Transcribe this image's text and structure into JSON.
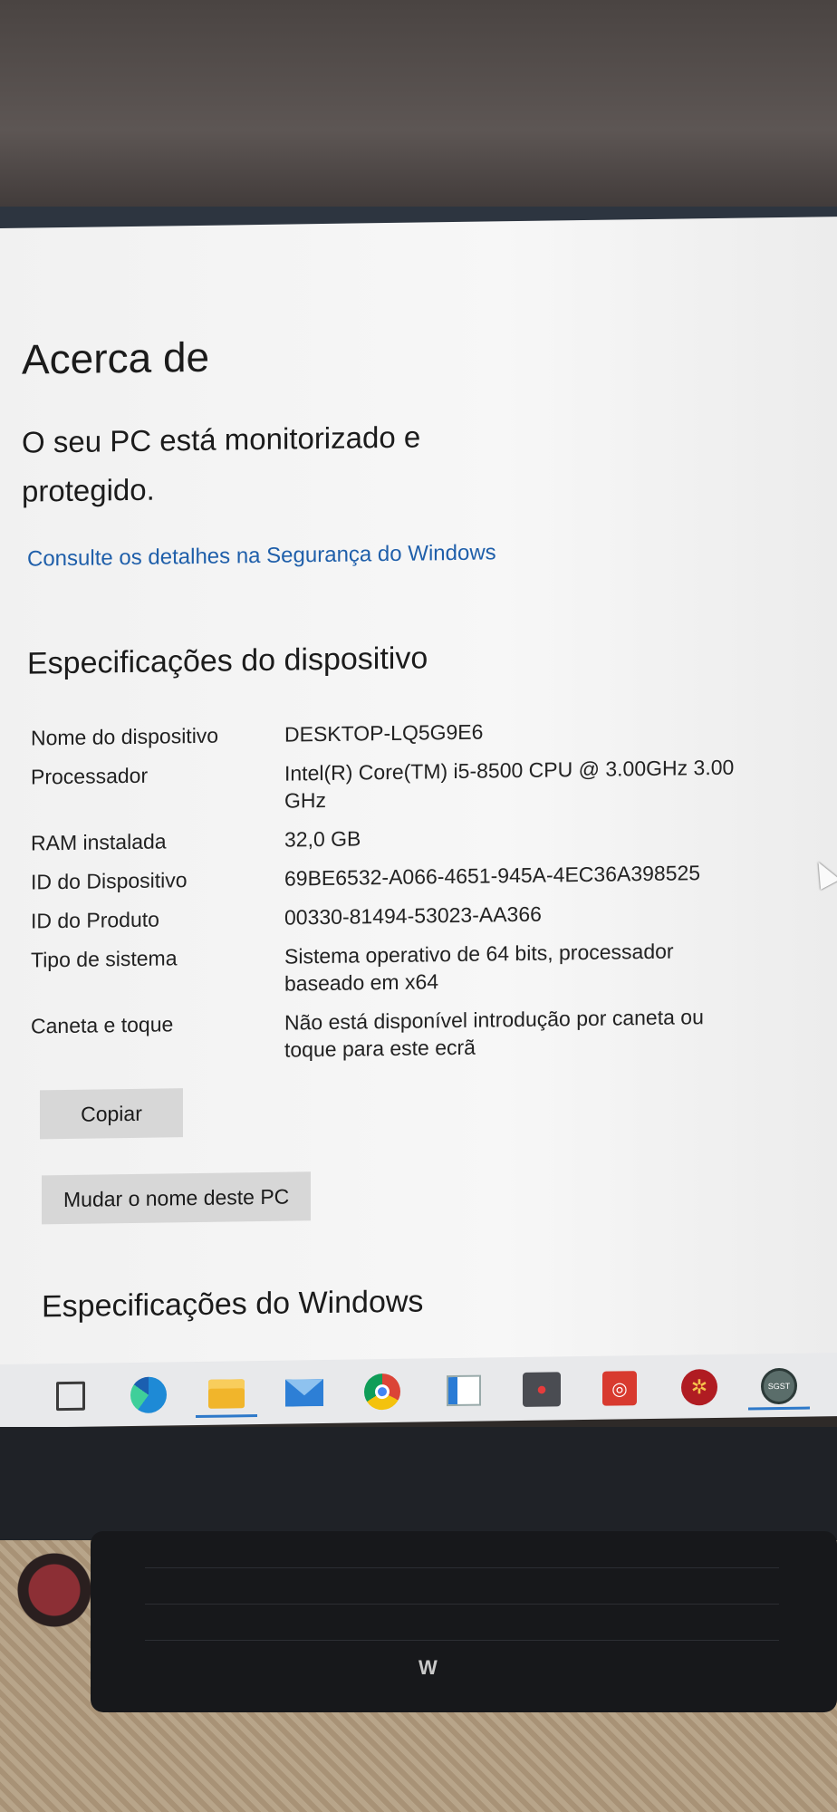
{
  "page": {
    "title": "Acerca de",
    "status_text": "O seu PC está monitorizado e protegido.",
    "security_link": "Consulte os detalhes na Segurança do Windows"
  },
  "device_specs": {
    "heading": "Especificações do dispositivo",
    "rows": [
      {
        "label": "Nome do dispositivo",
        "value": "DESKTOP-LQ5G9E6"
      },
      {
        "label": "Processador",
        "value": "Intel(R) Core(TM) i5-8500 CPU @ 3.00GHz 3.00 GHz"
      },
      {
        "label": "RAM instalada",
        "value": "32,0 GB"
      },
      {
        "label": "ID do Dispositivo",
        "value": "69BE6532-A066-4651-945A-4EC36A398525"
      },
      {
        "label": "ID do Produto",
        "value": "00330-81494-53023-AA366"
      },
      {
        "label": "Tipo de sistema",
        "value": "Sistema operativo de 64 bits, processador baseado em x64"
      },
      {
        "label": "Caneta e toque",
        "value": "Não está disponível introdução por caneta ou toque para este ecrã"
      }
    ],
    "copy_button": "Copiar",
    "rename_button": "Mudar o nome deste PC"
  },
  "windows_specs": {
    "heading": "Especificações do Windows"
  },
  "taskbar": {
    "icons": [
      "task-view-icon",
      "edge-icon",
      "file-explorer-icon",
      "mail-icon",
      "chrome-icon",
      "document-app-icon",
      "screen-recorder-icon",
      "command-app-icon",
      "gear-app-icon",
      "sgst-app-icon"
    ],
    "sgst_label": "SGST",
    "brand_mark": "W"
  },
  "colors": {
    "link": "#1f5faa",
    "button_bg": "#d7d7d7",
    "taskbar_active": "#2e79c9"
  }
}
